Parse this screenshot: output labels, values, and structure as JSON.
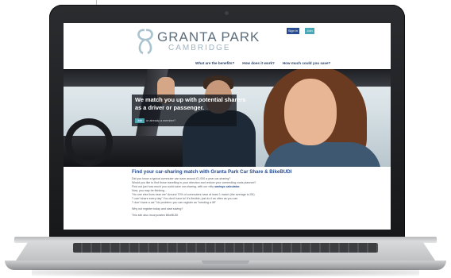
{
  "site": {
    "logo": {
      "title": "GRANTA PARK",
      "subtitle": "CAMBRIDGE",
      "accent": "#a9c3cf"
    },
    "header": {
      "signin_label": "Sign in",
      "join_label": "Join"
    },
    "nav": [
      {
        "label": "What are the benefits?"
      },
      {
        "label": "How does it work?"
      },
      {
        "label": "How much could you save?"
      }
    ],
    "hero": {
      "headline": "We match you up with potential sharers as a driver or passenger.",
      "join_label": "Join",
      "member_text": "or already a member?"
    },
    "content": {
      "title": "Find your car-sharing match with Granta Park Car Share & BikeBUDI",
      "lines": [
        "Did you know a typical commuter can save around £1,000 a year car-sharing?",
        "Would you like to find those travelling in your direction and reduce your commuting costs planned?",
        "Find out just how much you could save car-sharing, with our nifty",
        "Now, you may be thinking...",
        "\"No one else lives near me\" Around 70% of commuters have at least 1 match (the average is 25!)",
        "\"I can't share every day\" You don't have to! It's flexible; just do it as often as you can.",
        "\"I don't have a car\" No problem: you can register as \"needing a lift\"",
        "Why not register today and start saving?",
        "This site also incorporates BikeBUDI"
      ],
      "savings_link": "savings calculator."
    }
  },
  "colors": {
    "brand_blue": "#2a4d8f",
    "join_teal": "#4aa7b7",
    "body_text": "#555c63"
  }
}
